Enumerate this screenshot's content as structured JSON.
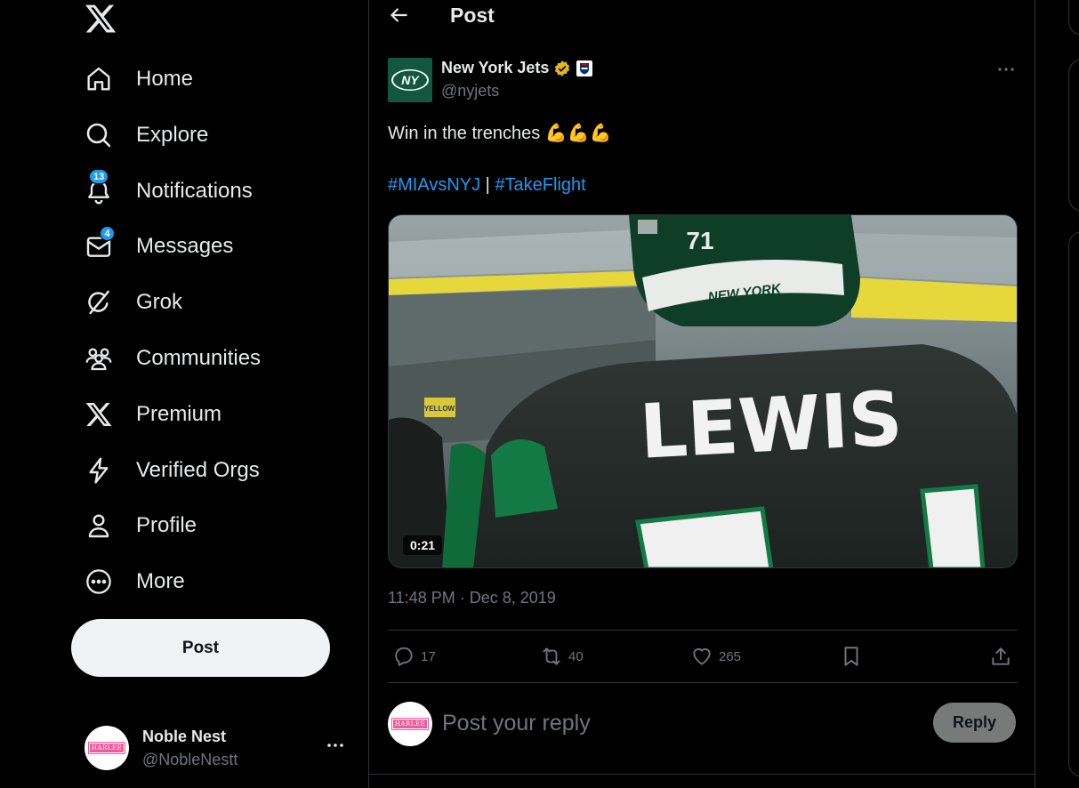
{
  "nav": {
    "items": [
      {
        "label": "Home",
        "icon": "home-icon"
      },
      {
        "label": "Explore",
        "icon": "search-icon"
      },
      {
        "label": "Notifications",
        "icon": "bell-icon",
        "badge": "13"
      },
      {
        "label": "Messages",
        "icon": "envelope-icon",
        "badge": "4"
      },
      {
        "label": "Grok",
        "icon": "grok-icon"
      },
      {
        "label": "Communities",
        "icon": "people-icon"
      },
      {
        "label": "Premium",
        "icon": "x-logo-icon"
      },
      {
        "label": "Verified Orgs",
        "icon": "lightning-icon"
      },
      {
        "label": "Profile",
        "icon": "person-icon"
      },
      {
        "label": "More",
        "icon": "more-circle-icon"
      }
    ],
    "post_label": "Post"
  },
  "account": {
    "name": "Noble Nest",
    "handle": "@NobleNestt",
    "avatar_text": "HARLEE"
  },
  "header": {
    "title": "Post"
  },
  "post": {
    "author_name": "New York Jets",
    "author_handle": "@nyjets",
    "avatar_text": "NY",
    "text": "Win in the trenches 💪💪💪",
    "hashtag1": "#MIAvsNYJ",
    "separator": "|",
    "hashtag2": "#TakeFlight",
    "video_duration": "0:21",
    "video_overlay": {
      "jersey_name": "LEWIS",
      "helmet_number": "71",
      "helmet_text": "NEW YORK",
      "sign_text": "YELLOW"
    },
    "timestamp": "11:48 PM · Dec 8, 2019",
    "stats": {
      "replies": "17",
      "reposts": "40",
      "likes": "265"
    }
  },
  "reply": {
    "placeholder": "Post your reply",
    "button_label": "Reply",
    "avatar_text": "HARLEE"
  },
  "colors": {
    "background": "#000000",
    "accent": "#1d9bf0",
    "text": "#e7e9ea",
    "muted": "#71767b",
    "border": "#2f3336",
    "jets_green": "#125740"
  }
}
